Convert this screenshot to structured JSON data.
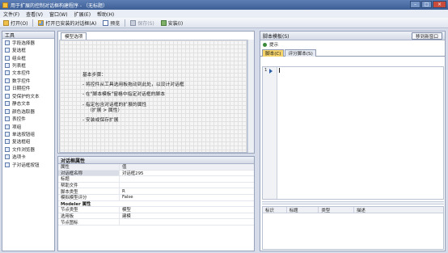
{
  "window": {
    "title": "用于扩展的控制对话框构建程序 - （无标题）"
  },
  "menu": [
    "文件(F)",
    "查看(V)",
    "窗口(W)",
    "扩展(E)",
    "帮助(H)"
  ],
  "toolbar": {
    "open": "打开(O)",
    "open_installed": "打开已安装的对话框(A)",
    "preview": "预览",
    "save": "保存(S)",
    "install": "安装(I)"
  },
  "tools": {
    "header": "工具",
    "items": [
      {
        "label": "字段选择器",
        "icon": "field-chooser-icon"
      },
      {
        "label": "复选框",
        "icon": "checkbox-icon"
      },
      {
        "label": "组合框",
        "icon": "combo-box-icon"
      },
      {
        "label": "列表框",
        "icon": "list-box-icon"
      },
      {
        "label": "文本控件",
        "icon": "text-control-icon"
      },
      {
        "label": "数字控件",
        "icon": "number-control-icon"
      },
      {
        "label": "日期控件",
        "icon": "date-control-icon"
      },
      {
        "label": "受保护的文本",
        "icon": "secured-text-icon"
      },
      {
        "label": "静态文本",
        "icon": "static-text-icon"
      },
      {
        "label": "颜色选取器",
        "icon": "color-picker-icon"
      },
      {
        "label": "表控件",
        "icon": "table-control-icon"
      },
      {
        "label": "项组",
        "icon": "item-group-icon"
      },
      {
        "label": "单选按钮组",
        "icon": "radio-group-icon"
      },
      {
        "label": "复选框组",
        "icon": "checkbox-group-icon"
      },
      {
        "label": "文件浏览器",
        "icon": "file-browser-icon"
      },
      {
        "label": "选项卡",
        "icon": "tab-icon"
      },
      {
        "label": "子对话框按钮",
        "icon": "sub-dialog-button-icon"
      }
    ]
  },
  "canvas": {
    "tab": "模型选项",
    "heading": "基本步骤：",
    "steps": [
      "- 将控件从工具选用板拖动到此处，以设计对话框",
      "- 在\"脚本模板\"窗格中指定对话框的脚本",
      "- 指定包含对话框的扩展的属性",
      "（扩展 > 属性）",
      "- 安装或保存扩展"
    ]
  },
  "properties": {
    "title": "对话框属性",
    "header": {
      "k": "属性",
      "v": "值"
    },
    "rows": [
      {
        "k": "对话框名称",
        "v": "对话框295",
        "sel": true
      },
      {
        "k": "标题",
        "v": ""
      },
      {
        "k": "帮助文件",
        "v": ""
      },
      {
        "k": "脚本类型",
        "v": "R"
      },
      {
        "k": "模拟模型评分",
        "v": "False"
      }
    ],
    "group": "Modeler 属性",
    "rows2": [
      {
        "k": "节点类型",
        "v": "模型"
      },
      {
        "k": "选用板",
        "v": "建模"
      },
      {
        "k": "节点图标",
        "v": ""
      }
    ]
  },
  "script": {
    "title": "脚本模板(S)",
    "new_window": "移到新窗口",
    "hint": "提示",
    "tabs": [
      "脚本(C)",
      "评分脚本(S)"
    ],
    "line": "1",
    "debug_cols": [
      "标识",
      "标题",
      "类型",
      "描述"
    ]
  }
}
